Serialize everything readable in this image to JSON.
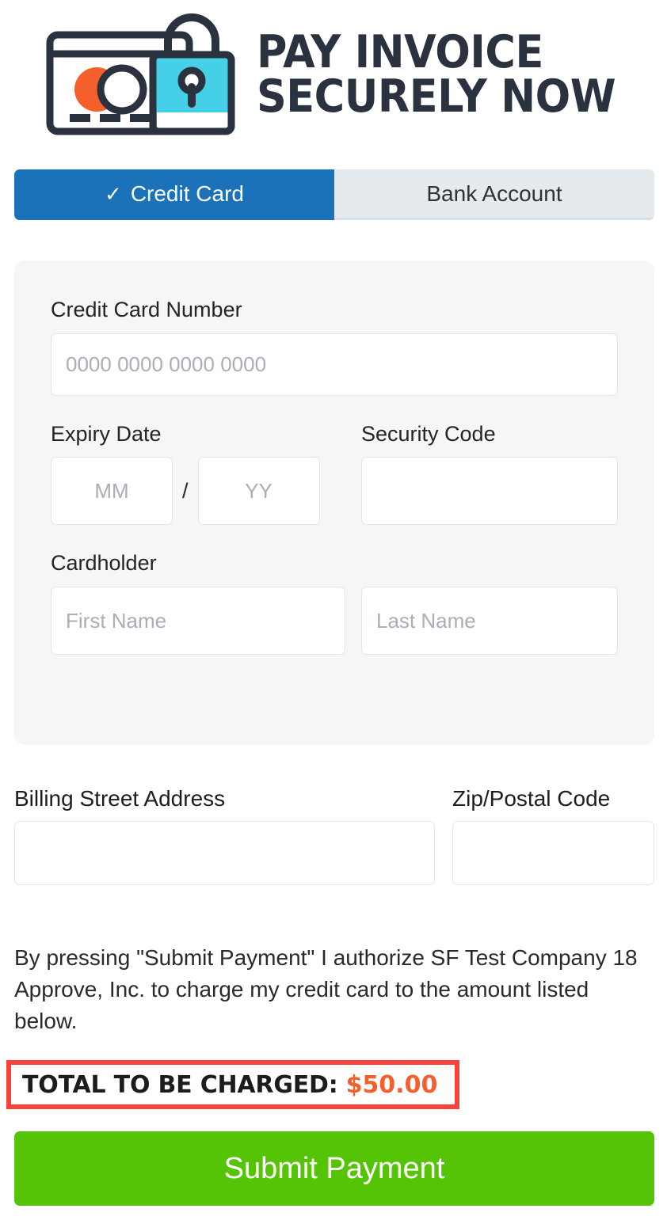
{
  "logo": {
    "icon_name": "credit-card-lock-icon",
    "line1": "PAY INVOICE",
    "line2": "SECURELY NOW",
    "colors": {
      "navy": "#2b323f",
      "orange": "#f4602c",
      "cyan": "#45d0e8"
    }
  },
  "tabs": [
    {
      "label": "Credit Card",
      "check": "✓",
      "active": true
    },
    {
      "label": "Bank Account",
      "check": "",
      "active": false
    }
  ],
  "card_form": {
    "card_number": {
      "label": "Credit Card Number",
      "placeholder": "0000 0000 0000 0000",
      "value": ""
    },
    "expiry": {
      "label": "Expiry Date",
      "separator": "/",
      "month": {
        "placeholder": "MM",
        "value": ""
      },
      "year": {
        "placeholder": "YY",
        "value": ""
      }
    },
    "security_code": {
      "label": "Security Code",
      "placeholder": "",
      "value": ""
    },
    "cardholder": {
      "label": "Cardholder",
      "first_name": {
        "placeholder": "First Name",
        "value": ""
      },
      "last_name": {
        "placeholder": "Last Name",
        "value": ""
      }
    }
  },
  "billing": {
    "street": {
      "label": "Billing Street Address",
      "placeholder": "",
      "value": ""
    },
    "zip": {
      "label": "Zip/Postal Code",
      "placeholder": "",
      "value": ""
    }
  },
  "authorization_text": "By pressing \"Submit Payment\" I authorize SF Test Company 18 Approve, Inc. to charge my credit card to the amount listed below.",
  "total": {
    "label": "TOTAL TO BE CHARGED:",
    "amount": "$50.00",
    "border_color": "#f9423a",
    "amount_color": "#f4602c"
  },
  "submit": {
    "label": "Submit Payment",
    "color": "#55c407"
  }
}
